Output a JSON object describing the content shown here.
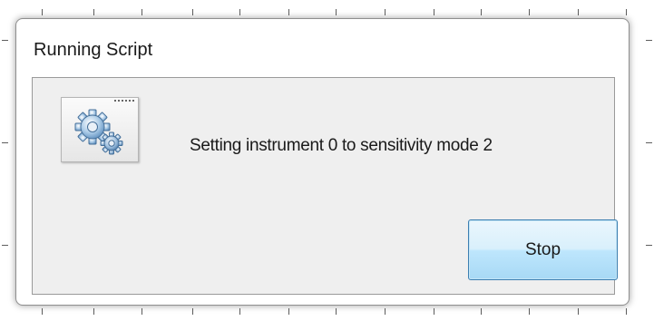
{
  "dialog": {
    "title": "Running Script",
    "message": "Setting instrument 0 to sensitivity mode 2",
    "icon": "gears-icon",
    "stop_label": "Stop"
  },
  "colors": {
    "button_border": "#3c7fb1",
    "button_fill": "#bee6fd",
    "client_bg": "#efefef"
  }
}
